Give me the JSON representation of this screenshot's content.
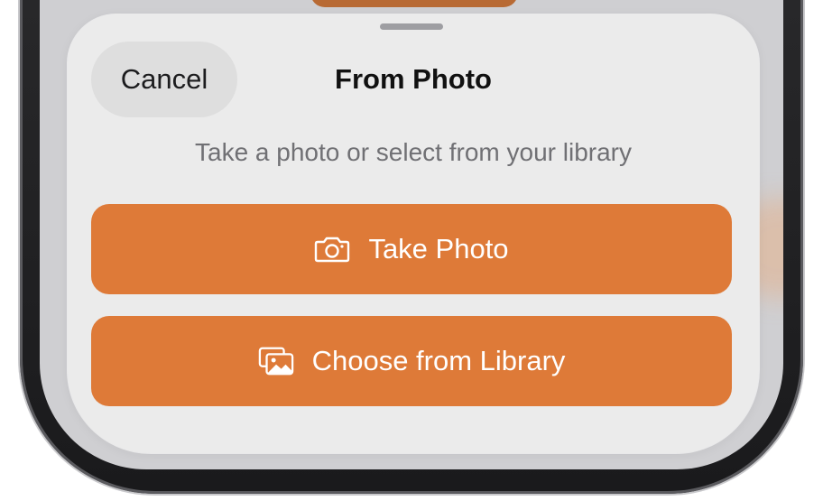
{
  "sheet": {
    "title": "From Photo",
    "subtitle": "Take a photo or select from your library",
    "cancel_label": "Cancel"
  },
  "actions": [
    {
      "label": "Take Photo",
      "icon": "camera-icon"
    },
    {
      "label": "Choose from Library",
      "icon": "photo-library-icon"
    }
  ],
  "colors": {
    "accent": "#de7a38",
    "sheet_background": "#ebebeb",
    "cancel_background": "#dedede",
    "subtitle_text": "#707074"
  }
}
